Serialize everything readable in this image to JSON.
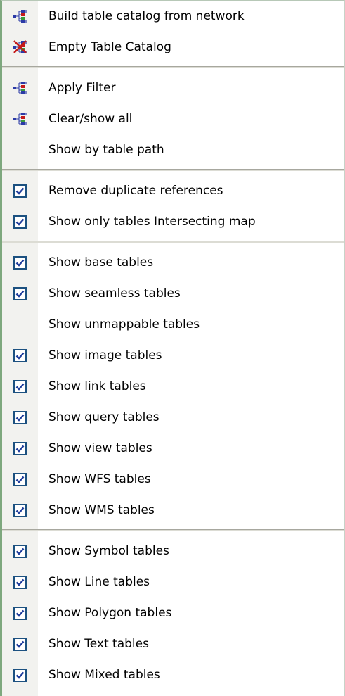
{
  "menu": {
    "groups": [
      {
        "items": [
          {
            "label": "Build table catalog from network",
            "icon": "network-tree-icon",
            "checked": null
          },
          {
            "label": "Empty Table Catalog",
            "icon": "empty-catalog-icon",
            "checked": null
          }
        ]
      },
      {
        "items": [
          {
            "label": "Apply Filter",
            "icon": "network-tree-icon",
            "checked": null
          },
          {
            "label": "Clear/show all",
            "icon": "network-tree-icon",
            "checked": null
          },
          {
            "label": "Show by table path",
            "icon": null,
            "checked": null
          }
        ]
      },
      {
        "items": [
          {
            "label": "Remove duplicate references",
            "icon": null,
            "checked": true
          },
          {
            "label": "Show only tables Intersecting map",
            "icon": null,
            "checked": true
          }
        ]
      },
      {
        "items": [
          {
            "label": "Show base tables",
            "icon": null,
            "checked": true
          },
          {
            "label": "Show seamless tables",
            "icon": null,
            "checked": true
          },
          {
            "label": "Show unmappable tables",
            "icon": null,
            "checked": false
          },
          {
            "label": "Show image tables",
            "icon": null,
            "checked": true
          },
          {
            "label": "Show link tables",
            "icon": null,
            "checked": true
          },
          {
            "label": "Show query tables",
            "icon": null,
            "checked": true
          },
          {
            "label": "Show view tables",
            "icon": null,
            "checked": true
          },
          {
            "label": "Show WFS tables",
            "icon": null,
            "checked": true
          },
          {
            "label": "Show WMS tables",
            "icon": null,
            "checked": true
          }
        ]
      },
      {
        "items": [
          {
            "label": "Show Symbol tables",
            "icon": null,
            "checked": true
          },
          {
            "label": "Show Line tables",
            "icon": null,
            "checked": true
          },
          {
            "label": "Show Polygon tables",
            "icon": null,
            "checked": true
          },
          {
            "label": "Show Text tables",
            "icon": null,
            "checked": true
          },
          {
            "label": "Show Mixed tables",
            "icon": null,
            "checked": true
          }
        ]
      }
    ]
  },
  "colors": {
    "icon_blue": "#2b3aa6",
    "icon_red": "#c41a1a",
    "icon_green": "#3a9a3a",
    "check_border": "#1c5180",
    "check_mark": "#1f3d9c"
  }
}
